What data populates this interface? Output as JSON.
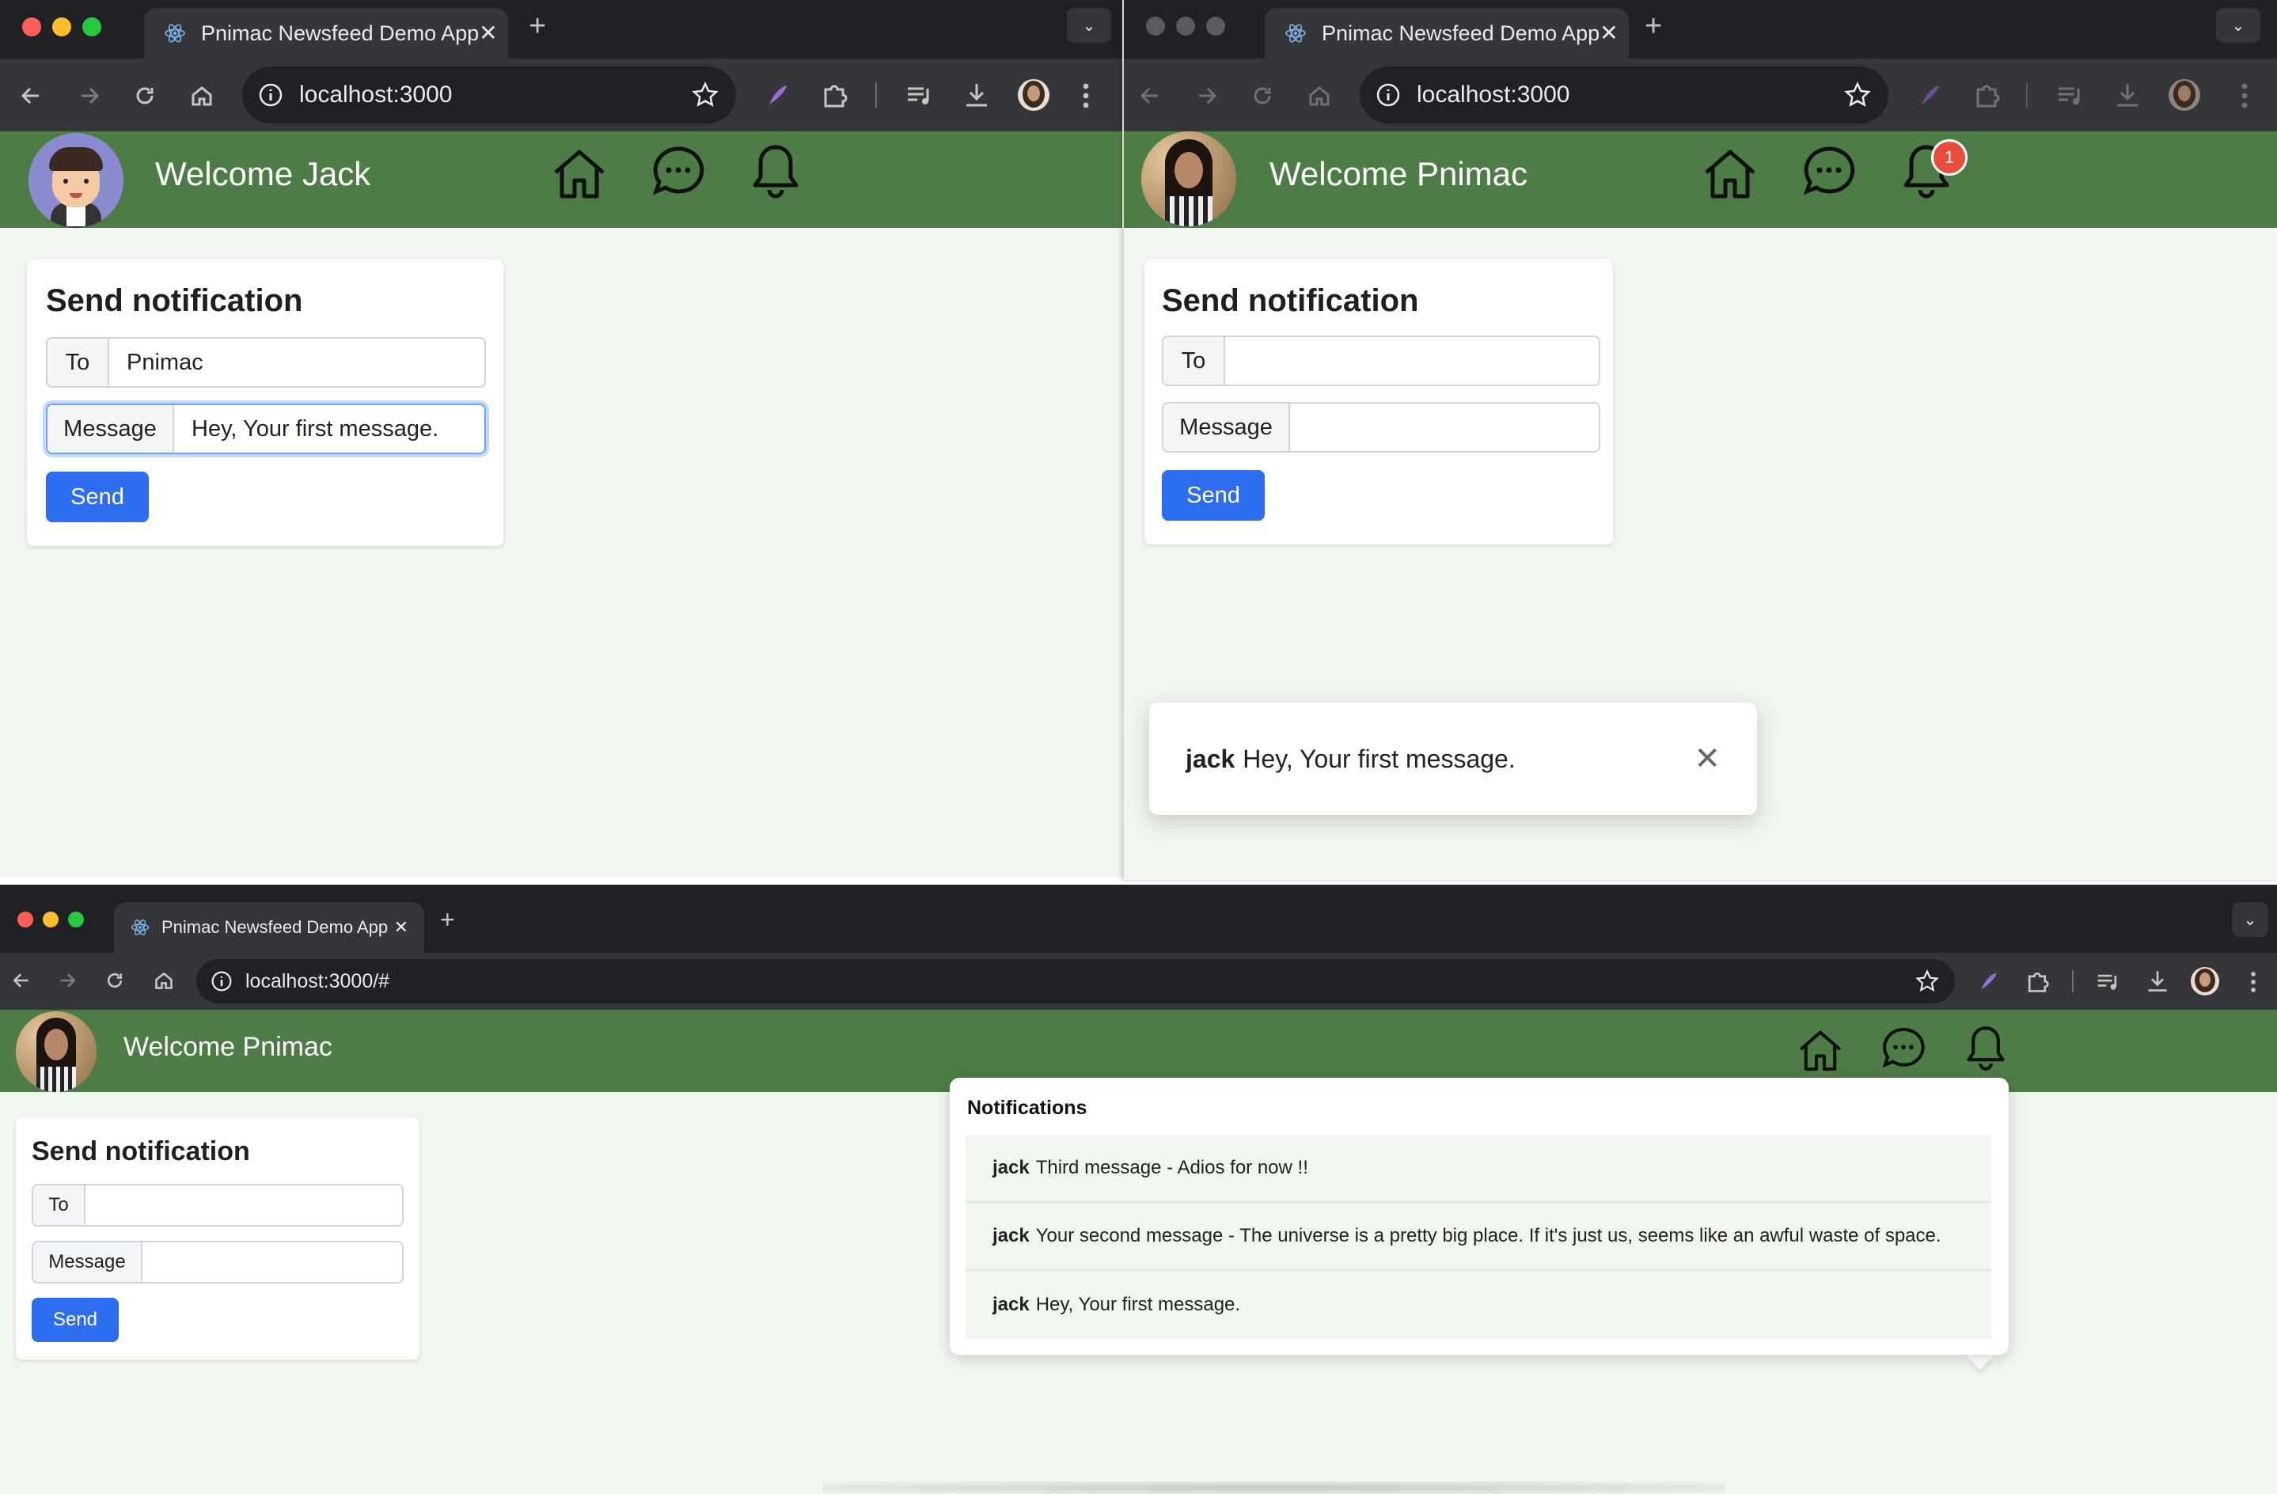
{
  "colors": {
    "tabstrip": "#202124",
    "toolbar": "#35363a",
    "appbar_green": "#4e7c46",
    "page_bg": "#f2f6f0",
    "primary_button": "#2f6df0",
    "badge_red": "#e74c3c",
    "traffic_close": "#ff5f57",
    "traffic_min": "#febc2e",
    "traffic_max": "#28c840"
  },
  "windows": [
    {
      "tab_title": "Pnimac Newsfeed Demo App",
      "url": "localhost:3000",
      "welcome": "Welcome Jack",
      "avatar": "cartoon-avatar",
      "notification_badge": "",
      "form": {
        "title": "Send notification",
        "to_label": "To",
        "to_value": "Pnimac",
        "message_label": "Message",
        "message_value": "Hey, Your first message.",
        "send_label": "Send"
      }
    },
    {
      "tab_title": "Pnimac Newsfeed Demo App",
      "url": "localhost:3000",
      "welcome": "Welcome Pnimac",
      "avatar": "photo-avatar",
      "notification_badge": "1",
      "form": {
        "title": "Send notification",
        "to_label": "To",
        "to_value": "",
        "message_label": "Message",
        "message_value": "",
        "send_label": "Send"
      },
      "toast": {
        "sender": "jack",
        "message": "Hey, Your first message."
      }
    },
    {
      "tab_title": "Pnimac Newsfeed Demo App",
      "url": "localhost:3000/#",
      "welcome": "Welcome Pnimac",
      "avatar": "photo-avatar",
      "notification_badge": "",
      "form": {
        "title": "Send notification",
        "to_label": "To",
        "to_value": "",
        "message_label": "Message",
        "message_value": "",
        "send_label": "Send"
      },
      "notifications": {
        "title": "Notifications",
        "items": [
          {
            "sender": "jack",
            "message": "Third message - Adios for now !!"
          },
          {
            "sender": "jack",
            "message": "Your second message - The universe is a pretty big place. If it's just us, seems like an awful waste of space."
          },
          {
            "sender": "jack",
            "message": "Hey, Your first message."
          }
        ]
      }
    }
  ],
  "icons": {
    "tab_favicon": "react-atom-icon",
    "tab_close": "close-icon",
    "new_tab": "plus-icon",
    "tab_search": "chevron-down-icon",
    "back": "arrow-left-icon",
    "forward": "arrow-right-icon",
    "reload": "reload-icon",
    "home": "home-icon",
    "site_info": "info-icon",
    "bookmark": "star-icon",
    "extension_feather": "feather-icon",
    "extensions": "puzzle-icon",
    "media": "media-queue-icon",
    "downloads": "download-icon",
    "profile": "profile-avatar-icon",
    "menu": "kebab-menu-icon",
    "app_home": "home-icon",
    "app_messages": "chat-icon",
    "app_notifications": "bell-icon"
  }
}
